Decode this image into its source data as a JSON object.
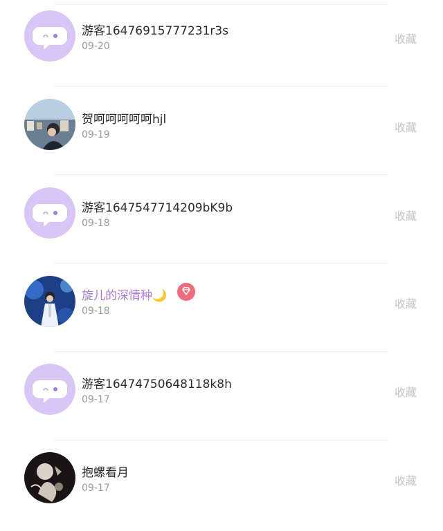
{
  "users": [
    {
      "name": "游客16476915777231r3s",
      "date": "09-20",
      "action": "收藏",
      "avatar": "default-chat-bubble-avatar"
    },
    {
      "name": "贺呵呵呵呵呵hjl",
      "date": "09-19",
      "action": "收藏",
      "avatar": "user-photo-avatar"
    },
    {
      "name": "游客1647547714209bK9b",
      "date": "09-18",
      "action": "收藏",
      "avatar": "default-chat-bubble-avatar"
    },
    {
      "name": "旋儿的深情种🌙",
      "date": "09-18",
      "action": "收藏",
      "avatar": "user-photo-avatar",
      "badge": "diamond-vip-badge"
    },
    {
      "name": "游客16474750648118k8h",
      "date": "09-17",
      "action": "收藏",
      "avatar": "default-chat-bubble-avatar"
    },
    {
      "name": "抱螺看月",
      "date": "09-17",
      "action": "收藏",
      "avatar": "user-photo-avatar"
    }
  ],
  "colors": {
    "default_avatar_bg": "#d8c6f6",
    "vip_name": "#b07ad9",
    "badge": "#f06c7d",
    "muted": "#9a9a9a"
  }
}
